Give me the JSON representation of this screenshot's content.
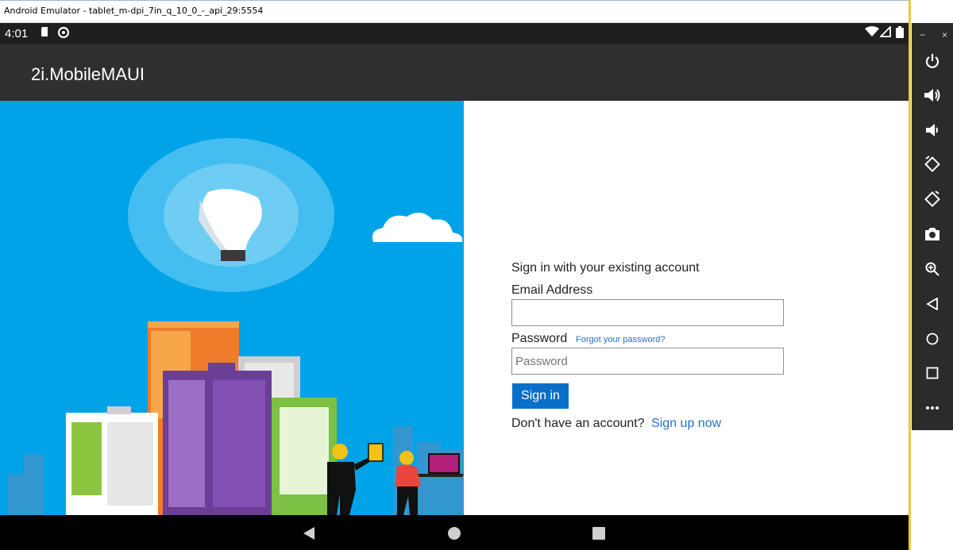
{
  "window": {
    "title": "Android Emulator - tablet_m-dpi_7in_q_10_0_-_api_29:5554"
  },
  "statusbar": {
    "time": "4:01"
  },
  "app": {
    "title": "2i.MobileMAUI"
  },
  "form": {
    "heading": "Sign in with your existing account",
    "email_label": "Email Address",
    "email_value": "",
    "password_label": "Password",
    "forgot_link": "Forgot your password?",
    "password_placeholder": "Password",
    "signin_button": "Sign in",
    "no_account_text": "Don't have an account?",
    "signup_link": "Sign up now"
  },
  "sidebar": {
    "minimize": "−",
    "close": "×",
    "icons": [
      "power-icon",
      "volume-up-icon",
      "volume-down-icon",
      "rotate-left-icon",
      "rotate-right-icon",
      "camera-icon",
      "zoom-icon",
      "back-icon",
      "home-icon",
      "overview-icon",
      "more-icon"
    ]
  },
  "colors": {
    "hero_bg": "#00a3e8",
    "appbar": "#2f2f2f",
    "accent": "#0a6fc8",
    "link": "#2a6fc9"
  }
}
